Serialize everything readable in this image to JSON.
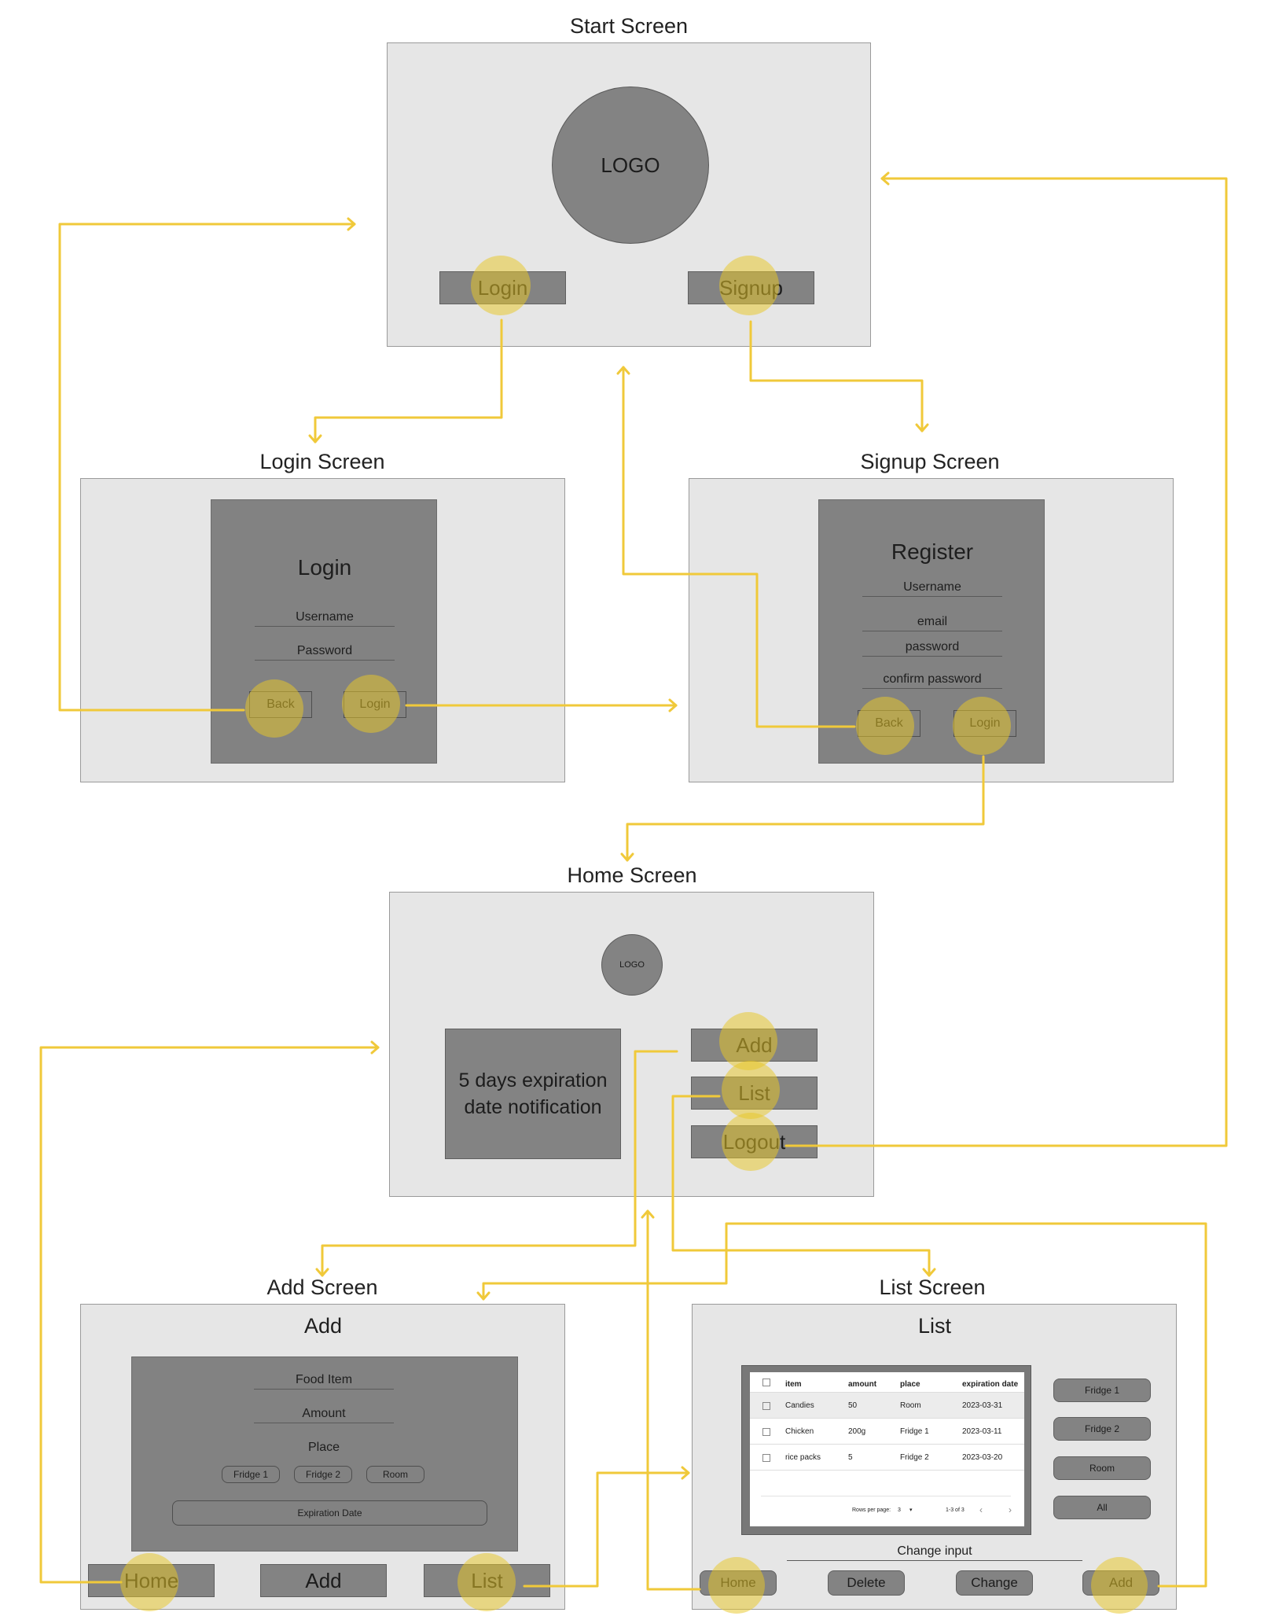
{
  "titles": {
    "start": "Start Screen",
    "login": "Login Screen",
    "signup": "Signup Screen",
    "home": "Home Screen",
    "add": "Add Screen",
    "list": "List Screen"
  },
  "start": {
    "logo": "LOGO",
    "login_btn": "Login",
    "signup_btn": "Signup"
  },
  "login": {
    "heading": "Login",
    "username": "Username",
    "password": "Password",
    "back_btn": "Back",
    "login_btn": "Login"
  },
  "signup": {
    "heading": "Register",
    "username": "Username",
    "email": "email",
    "password": "password",
    "confirm": "confirm password",
    "back_btn": "Back",
    "login_btn": "Login"
  },
  "home": {
    "logo": "LOGO",
    "notification": "5 days expiration date notification",
    "add_btn": "Add",
    "list_btn": "List",
    "logout_btn": "Logout"
  },
  "add": {
    "heading": "Add",
    "food_item": "Food Item",
    "amount": "Amount",
    "place": "Place",
    "places": [
      "Fridge 1",
      "Fridge 2",
      "Room"
    ],
    "expiration": "Expiration Date",
    "nav": {
      "home": "Home",
      "add": "Add",
      "list": "List"
    }
  },
  "list": {
    "heading": "List",
    "columns": [
      "item",
      "amount",
      "place",
      "expiration date"
    ],
    "rows": [
      [
        "Candies",
        "50",
        "Room",
        "2023-03-31"
      ],
      [
        "Chicken",
        "200g",
        "Fridge 1",
        "2023-03-11"
      ],
      [
        "rice packs",
        "5",
        "Fridge 2",
        "2023-03-20"
      ]
    ],
    "footer": {
      "rows_per_page": "Rows per page:",
      "rpp_value": "3",
      "range": "1-3 of 3"
    },
    "filters": [
      "Fridge 1",
      "Fridge 2",
      "Room",
      "All"
    ],
    "change_input": "Change input",
    "actions": {
      "home": "Home",
      "delete": "Delete",
      "change": "Change",
      "add": "Add"
    }
  },
  "colors": {
    "screen_bg": "#e6e6e6",
    "panel": "#828282",
    "arrow": "#f0c93a",
    "highlight": "#e8c828"
  }
}
